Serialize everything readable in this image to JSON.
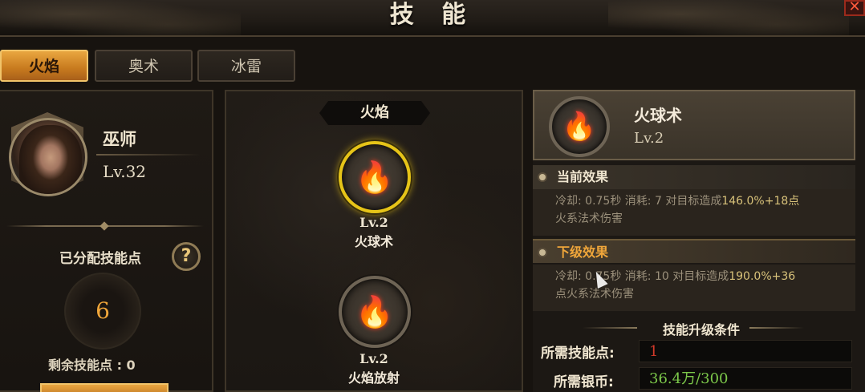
{
  "window": {
    "title": "技 能",
    "close_icon": "close-icon"
  },
  "tabs": [
    {
      "label": "火焰",
      "active": true
    },
    {
      "label": "奥术",
      "active": false
    },
    {
      "label": "冰雷",
      "active": false
    }
  ],
  "character": {
    "name": "巫师",
    "level": "Lv.32",
    "allocated_label": "已分配技能点",
    "allocated_value": "6",
    "remaining_label": "剩余技能点 : 0"
  },
  "skill_tree": {
    "school": "火焰",
    "nodes": [
      {
        "level": "Lv.2",
        "name": "火球术",
        "icon": "fireball-icon",
        "selected": true
      },
      {
        "level": "Lv.2",
        "name": "火焰放射",
        "icon": "flame-spray-icon",
        "selected": false
      }
    ]
  },
  "detail": {
    "icon": "fireball-icon",
    "name": "火球术",
    "level": "Lv.2",
    "current_title": "当前效果",
    "current_text_prefix": "冷却: 0.75秒  消耗: 7  对目标造成",
    "current_text_highlight": "146.0%+18",
    "current_text_suffix1": "点",
    "current_text_line2": "火系法术伤害",
    "next_title": "下级效果",
    "next_text_prefix": "冷却: 0.75秒  消耗: 10  对目标造成",
    "next_text_highlight": "190.0%+36",
    "next_text_line2": "点火系法术伤害",
    "requirements_title": "技能升级条件",
    "req_points_label": "所需技能点:",
    "req_points_value": "1",
    "req_silver_label": "所需银币:",
    "req_silver_value": "36.4万/300"
  },
  "colors": {
    "accent_orange": "#e9a640",
    "selected_ring": "#e6c418",
    "fire_red": "#e0241a",
    "highlight_yellow": "#d8c27a",
    "req_points_red": "#d23a2a",
    "req_silver_green": "#7cc84a"
  }
}
